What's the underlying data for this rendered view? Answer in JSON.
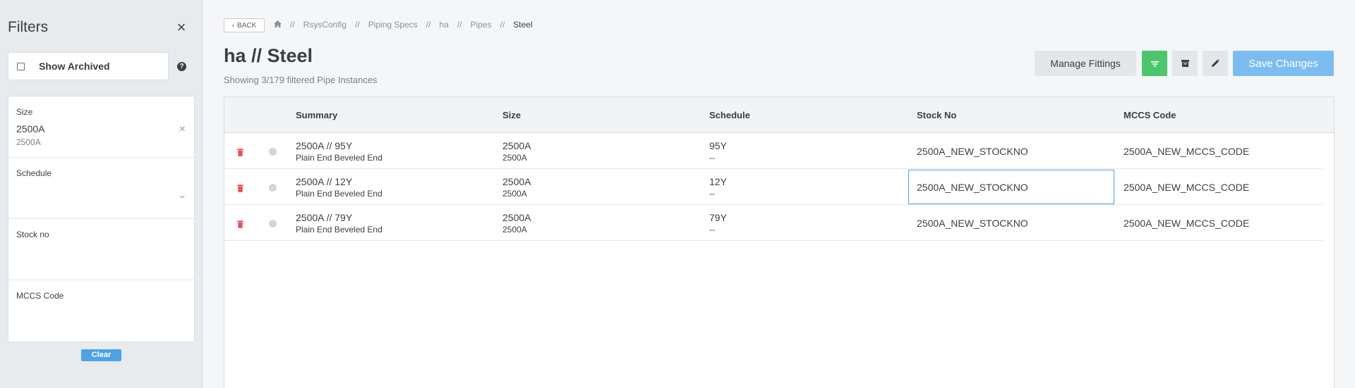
{
  "sidebar": {
    "title": "Filters",
    "show_archived_label": "Show Archived",
    "filters": [
      {
        "label": "Size",
        "value": "2500A",
        "sub": "2500A"
      },
      {
        "label": "Schedule",
        "value": "",
        "sub": ""
      },
      {
        "label": "Stock no",
        "value": "",
        "sub": ""
      },
      {
        "label": "MCCS Code",
        "value": "",
        "sub": ""
      }
    ],
    "clear_label": "Clear"
  },
  "header": {
    "back_label": "BACK",
    "breadcrumbs": [
      "RsysConfig",
      "Piping Specs",
      "ha",
      "Pipes",
      "Steel"
    ],
    "separator": "//",
    "title": "ha // Steel",
    "subtitle": "Showing 3/179 filtered Pipe Instances"
  },
  "toolbar": {
    "manage_fittings_label": "Manage Fittings",
    "save_changes_label": "Save Changes"
  },
  "table": {
    "columns": [
      "Summary",
      "Size",
      "Schedule",
      "Stock No",
      "MCCS Code"
    ],
    "rows": [
      {
        "summary": "2500A // 95Y",
        "summary_sub": "Plain End Beveled End",
        "size": "2500A",
        "size_sub": "2500A",
        "schedule": "95Y",
        "schedule_sub": "--",
        "stock_no": "2500A_NEW_STOCKNO",
        "mccs": "2500A_NEW_MCCS_CODE"
      },
      {
        "summary": "2500A // 12Y",
        "summary_sub": "Plain End Beveled End",
        "size": "2500A",
        "size_sub": "2500A",
        "schedule": "12Y",
        "schedule_sub": "--",
        "stock_no": "2500A_NEW_STOCKNO",
        "mccs": "2500A_NEW_MCCS_CODE"
      },
      {
        "summary": "2500A // 79Y",
        "summary_sub": "Plain End Beveled End",
        "size": "2500A",
        "size_sub": "2500A",
        "schedule": "79Y",
        "schedule_sub": "--",
        "stock_no": "2500A_NEW_STOCKNO",
        "mccs": "2500A_NEW_MCCS_CODE"
      }
    ]
  },
  "icons": {
    "close": "close-icon",
    "help": "question-circle-icon",
    "home": "home-icon",
    "filter": "filter-icon",
    "archive": "archive-icon",
    "edit": "pencil-icon",
    "delete": "trash-icon",
    "status": "status-dot-icon"
  },
  "colors": {
    "accent": "#4da3e6",
    "filter_active": "#4cc56b",
    "save_disabled": "#7cbcf0",
    "delete": "#e8525c"
  }
}
